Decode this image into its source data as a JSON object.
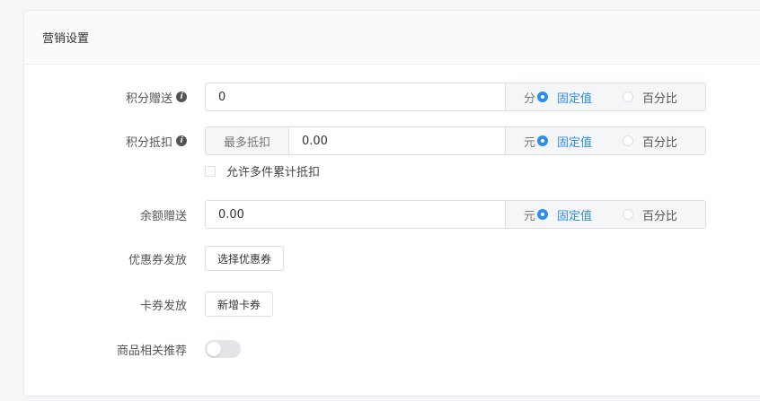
{
  "panel": {
    "title": "营销设置"
  },
  "points_gift": {
    "label": "积分赠送",
    "value": "0",
    "unit": "分",
    "options": [
      "固定值",
      "百分比"
    ],
    "selected": "固定值"
  },
  "points_deduct": {
    "label": "积分抵扣",
    "prefix": "最多抵扣",
    "value": "0.00",
    "unit": "元",
    "options": [
      "固定值",
      "百分比"
    ],
    "selected": "固定值",
    "checkbox_label": "允许多件累计抵扣",
    "checkbox_checked": false
  },
  "balance_gift": {
    "label": "余额赠送",
    "value": "0.00",
    "unit": "元",
    "options": [
      "固定值",
      "百分比"
    ],
    "selected": "固定值"
  },
  "coupon": {
    "label": "优惠券发放",
    "button": "选择优惠券"
  },
  "card": {
    "label": "卡券发放",
    "button": "新增卡券"
  },
  "recommend": {
    "label": "商品相关推荐",
    "enabled": false
  },
  "colors": {
    "accent": "#2d8cf0"
  },
  "icons": {
    "info": "info-icon"
  }
}
